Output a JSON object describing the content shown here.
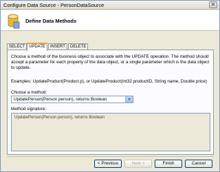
{
  "window": {
    "title": "Configure Data Source - PersonDataSource",
    "close_glyph": "✕"
  },
  "header": {
    "heading": "Define Data Methods"
  },
  "tabs": [
    {
      "label": "SELECT",
      "active": false
    },
    {
      "label": "UPDATE",
      "active": true
    },
    {
      "label": "INSERT",
      "active": false
    },
    {
      "label": "DELETE",
      "active": false
    }
  ],
  "panel": {
    "description": "Choose a method of the business object to associate with the UPDATE operation. The method should accept a parameter for each property of the data object, or a single parameter which is the data object to update.",
    "examples": "Examples: UpdateProduct(Product p), or UpdateProduct(Int32 productID, String name, Double price)",
    "choose_label": "Choose a method:",
    "method_selected": "UpdatePerson(Person person), returns Boolean",
    "signature_label": "Method signature:",
    "signature_value": "UpdatePerson(Person person), returns Boolean"
  },
  "buttons": {
    "previous": "< Previous",
    "next": "Next >",
    "finish": "Finish",
    "cancel": "Cancel"
  },
  "colors": {
    "active_tab_accent": "#f2a33a",
    "dialog_bg": "#ece9d8"
  },
  "icons": {
    "header": "database-icon",
    "close": "close-icon",
    "dropdown": "chevron-down-icon"
  }
}
